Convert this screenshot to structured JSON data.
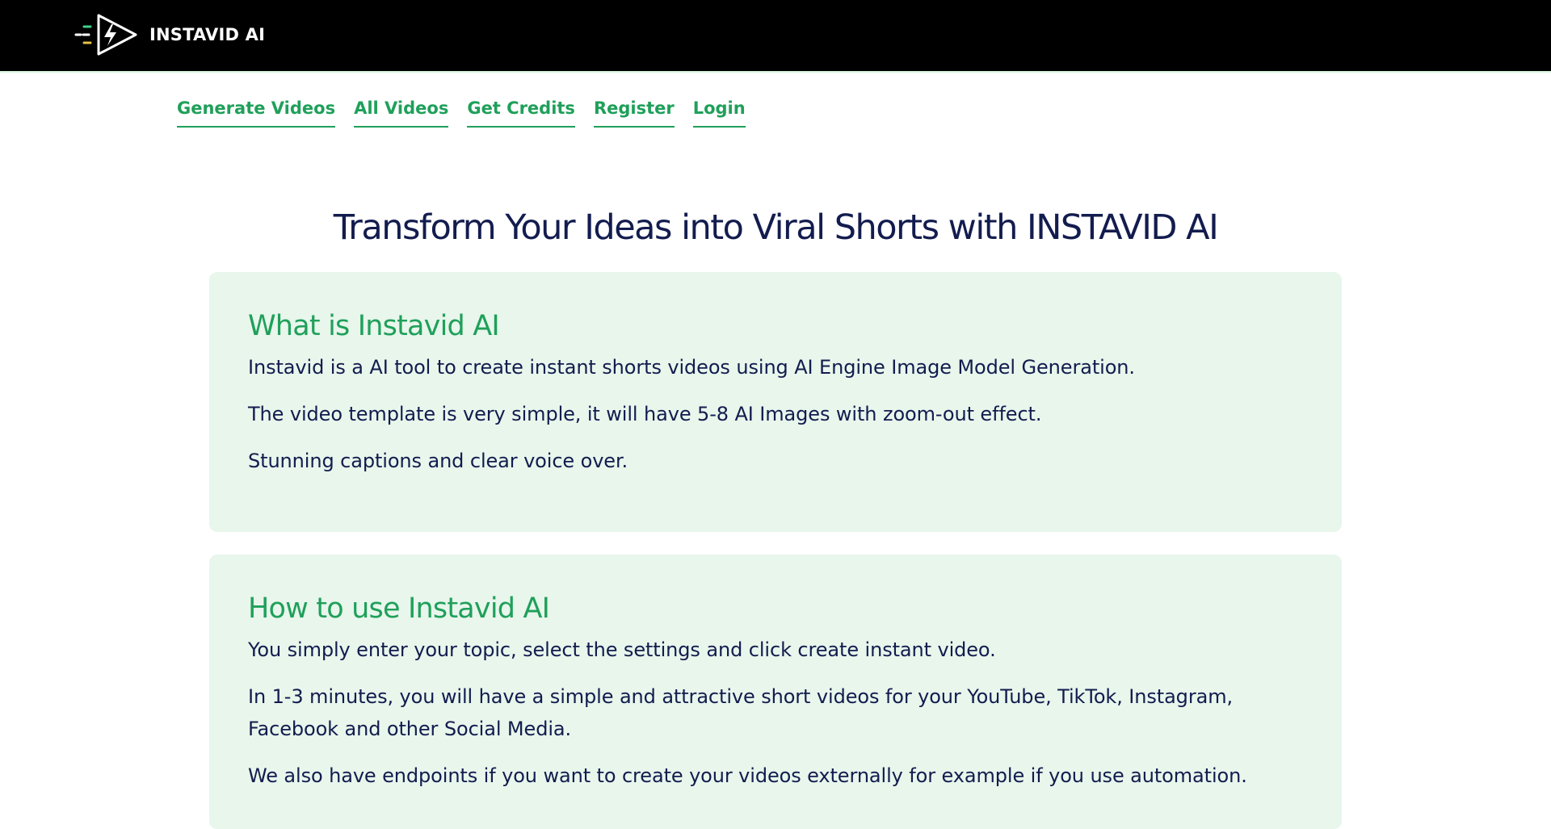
{
  "header": {
    "brand": "INSTAVID AI",
    "logo_icon": "play-lightning-logo-icon"
  },
  "nav": {
    "items": [
      {
        "label": "Generate Videos"
      },
      {
        "label": "All Videos"
      },
      {
        "label": "Get Credits"
      },
      {
        "label": "Register"
      },
      {
        "label": "Login"
      }
    ]
  },
  "hero": {
    "title": "Transform Your Ideas into Viral Shorts with INSTAVID AI"
  },
  "sections": [
    {
      "title": "What is Instavid AI",
      "paragraphs": [
        "Instavid is a AI tool to create instant shorts videos using AI Engine Image Model Generation.",
        "The video template is very simple, it will have 5-8 AI Images with zoom-out effect.",
        "Stunning captions and clear voice over."
      ]
    },
    {
      "title": "How to use Instavid AI",
      "paragraphs": [
        "You simply enter your topic, select the settings and click create instant video.",
        "In 1-3 minutes, you will have a simple and attractive short videos for your YouTube, TikTok, Instagram, Facebook and other Social Media.",
        "We also have endpoints if you want to create your videos externally for example if you use automation."
      ]
    }
  ],
  "colors": {
    "header_bg": "#000000",
    "accent_green": "#1fa05a",
    "navy_text": "#131c4e",
    "card_bg": "#e8f6ec"
  }
}
